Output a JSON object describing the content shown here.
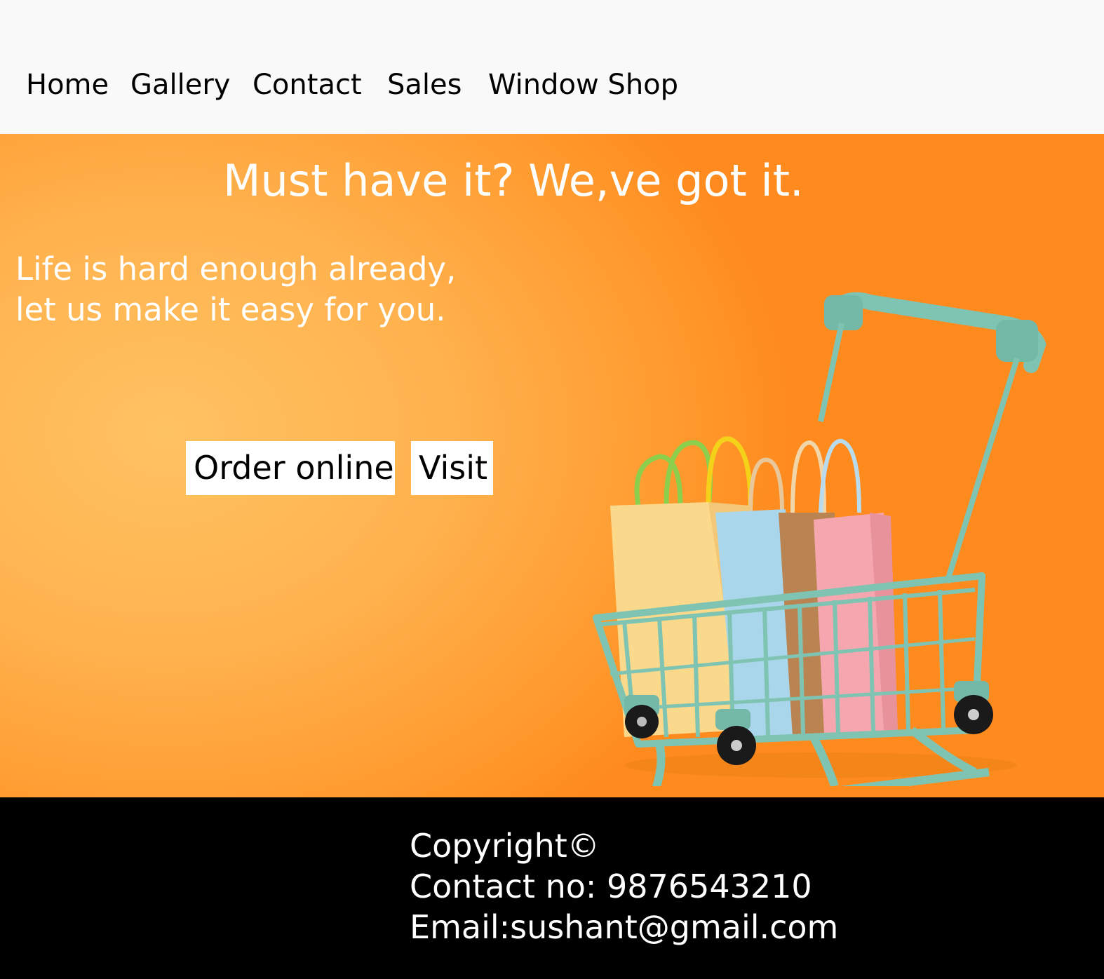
{
  "nav": {
    "items": [
      {
        "label": "Home"
      },
      {
        "label": "Gallery"
      },
      {
        "label": "Contact"
      },
      {
        "label": "Sales"
      },
      {
        "label": "Window Shop"
      }
    ]
  },
  "hero": {
    "headline": "Must have it? We,ve got it.",
    "tagline_line1": "Life is hard enough already,",
    "tagline_line2": "let us make it easy for you.",
    "order_button": "Order online",
    "visit_button": "Visit",
    "image": "shopping-cart-with-bags"
  },
  "footer": {
    "copyright": "Copyright©",
    "contact": "Contact no: 9876543210",
    "email": "Email:sushant@gmail.com"
  },
  "colors": {
    "hero_bg": "#ffb24e",
    "cart": "#7fc4b3",
    "footer_bg": "#000000"
  }
}
